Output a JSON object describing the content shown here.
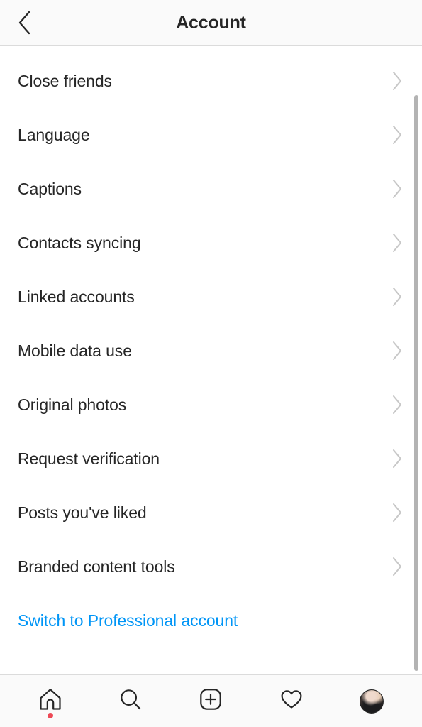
{
  "header": {
    "title": "Account",
    "back_icon": "chevron-left-icon"
  },
  "list": {
    "chevron_icon": "chevron-right-icon",
    "items": [
      {
        "label": "Close friends",
        "accent": false,
        "chevron": true
      },
      {
        "label": "Language",
        "accent": false,
        "chevron": true
      },
      {
        "label": "Captions",
        "accent": false,
        "chevron": true
      },
      {
        "label": "Contacts syncing",
        "accent": false,
        "chevron": true
      },
      {
        "label": "Linked accounts",
        "accent": false,
        "chevron": true
      },
      {
        "label": "Mobile data use",
        "accent": false,
        "chevron": true
      },
      {
        "label": "Original photos",
        "accent": false,
        "chevron": true
      },
      {
        "label": "Request verification",
        "accent": false,
        "chevron": true
      },
      {
        "label": "Posts you've liked",
        "accent": false,
        "chevron": true
      },
      {
        "label": "Branded content tools",
        "accent": false,
        "chevron": true
      },
      {
        "label": "Switch to Professional account",
        "accent": true,
        "chevron": false
      }
    ]
  },
  "bottom_nav": {
    "items": [
      {
        "icon": "home-icon",
        "badge": true
      },
      {
        "icon": "search-icon",
        "badge": false
      },
      {
        "icon": "add-post-icon",
        "badge": false
      },
      {
        "icon": "heart-icon",
        "badge": false
      },
      {
        "icon": "profile-avatar",
        "badge": false
      }
    ]
  },
  "colors": {
    "accent_blue": "#0095f6",
    "text_primary": "#262626",
    "chevron_gray": "#c7c7c7",
    "badge_red": "#ed4956",
    "bar_background": "#fafafa",
    "divider": "#dbdbdb",
    "scrollbar": "#b3b3b3"
  },
  "scrollbar": {
    "visible": true,
    "name": "vertical-scrollbar"
  }
}
